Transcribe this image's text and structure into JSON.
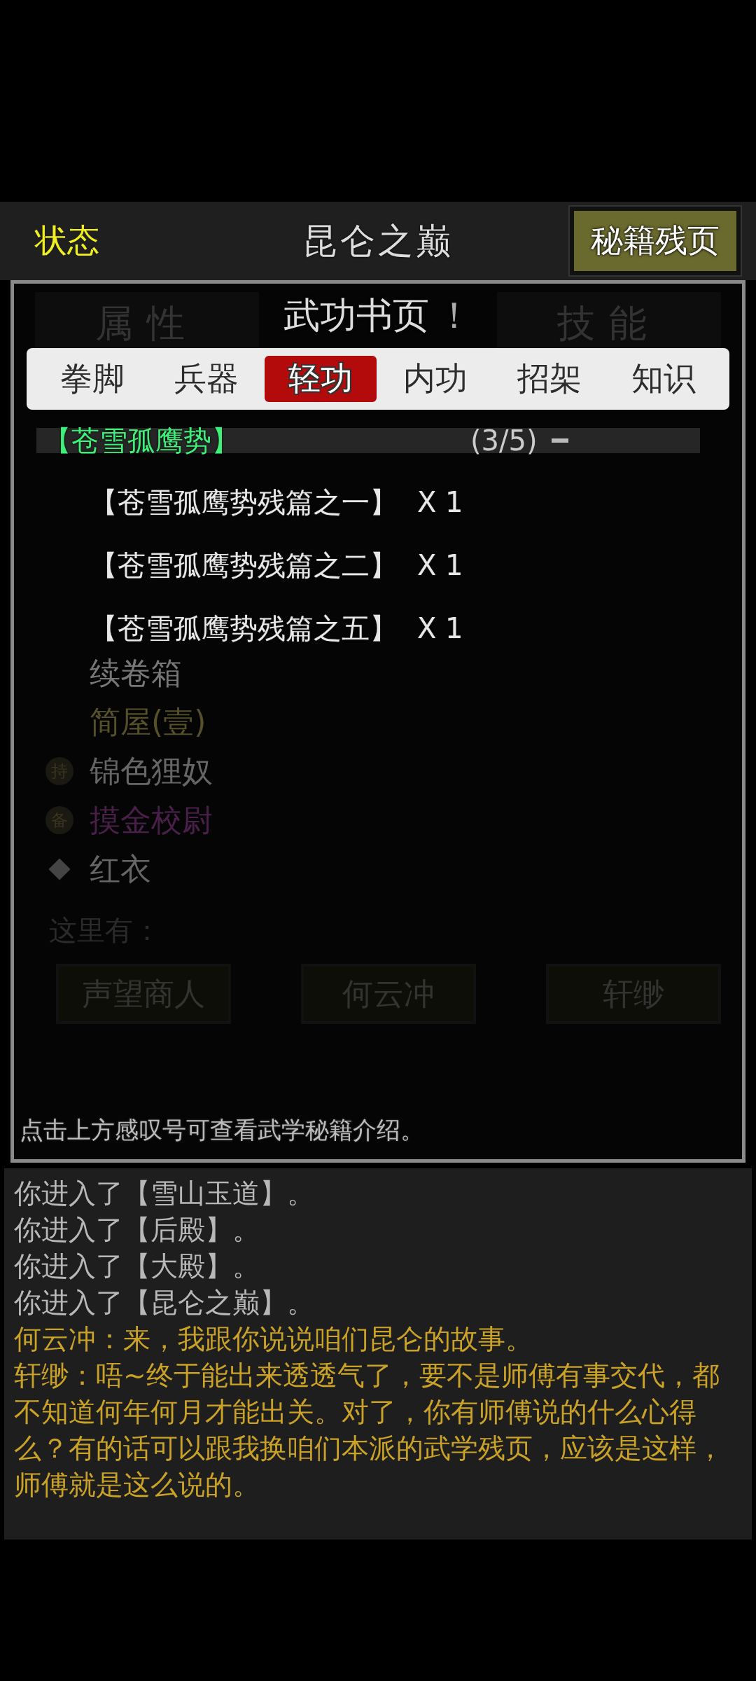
{
  "header": {
    "status_label": "状态",
    "title": "昆仑之巅",
    "button": "秘籍残页"
  },
  "background": {
    "tabs": [
      "属性",
      "技能"
    ],
    "items": [
      {
        "label": "续卷箱",
        "kind": "plain",
        "color": "#777777"
      },
      {
        "label": "简屋(壹)",
        "kind": "plain",
        "color": "#55502a"
      },
      {
        "label": "锦色狸奴",
        "kind": "badge",
        "badge": "持",
        "color": "#666666"
      },
      {
        "label": "摸金校尉",
        "kind": "badge",
        "badge": "备",
        "color": "#4a1f4a"
      },
      {
        "label": "红衣",
        "kind": "diamond",
        "color": "#666666"
      }
    ],
    "here_label": "这里有：",
    "npcs": [
      "声望商人",
      "何云冲",
      "轩缈"
    ]
  },
  "modal": {
    "title": "武功书页",
    "info": "！",
    "tabs": [
      {
        "label": "拳脚",
        "selected": false
      },
      {
        "label": "兵器",
        "selected": false
      },
      {
        "label": "轻功",
        "selected": true
      },
      {
        "label": "内功",
        "selected": false
      },
      {
        "label": "招架",
        "selected": false
      },
      {
        "label": "知识",
        "selected": false
      }
    ],
    "group": {
      "name": "【苍雪孤鹰势】",
      "count": "(3/5)",
      "expanded": true,
      "items": [
        {
          "name": "【苍雪孤鹰势残篇之一】",
          "qty": "X 1"
        },
        {
          "name": "【苍雪孤鹰势残篇之二】",
          "qty": "X 1"
        },
        {
          "name": "【苍雪孤鹰势残篇之五】",
          "qty": "X 1"
        }
      ]
    },
    "hint": "点击上方感叹号可查看武学秘籍介绍。"
  },
  "log": [
    {
      "kind": "system",
      "text": "你进入了【雪山玉道】。"
    },
    {
      "kind": "system",
      "text": "你进入了【后殿】。"
    },
    {
      "kind": "system",
      "text": "你进入了【大殿】。"
    },
    {
      "kind": "system",
      "text": "你进入了【昆仑之巅】。"
    },
    {
      "kind": "speech",
      "text": "何云冲：来，我跟你说说咱们昆仑的故事。"
    },
    {
      "kind": "speech",
      "text": "轩缈：唔~终于能出来透透气了，要不是师傅有事交代，都不知道何年何月才能出关。对了，你有师傅说的什么心得么？有的话可以跟我换咱们本派的武学残页，应该是这样，师傅就是这么说的。"
    }
  ]
}
